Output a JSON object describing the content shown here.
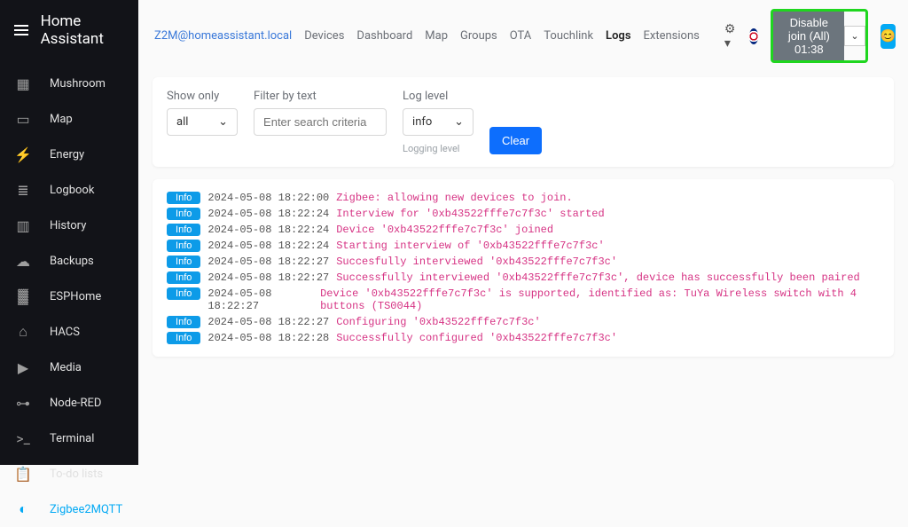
{
  "app_title": "Home Assistant",
  "sidebar": {
    "items": [
      {
        "label": "Mushroom",
        "icon": "dashboard-icon"
      },
      {
        "label": "Map",
        "icon": "map-marker-icon"
      },
      {
        "label": "Energy",
        "icon": "lightning-icon"
      },
      {
        "label": "Logbook",
        "icon": "list-icon"
      },
      {
        "label": "History",
        "icon": "chart-icon"
      },
      {
        "label": "Backups",
        "icon": "cloud-icon"
      },
      {
        "label": "ESPHome",
        "icon": "chip-icon"
      },
      {
        "label": "HACS",
        "icon": "hacs-icon"
      },
      {
        "label": "Media",
        "icon": "play-icon"
      },
      {
        "label": "Node-RED",
        "icon": "node-icon"
      },
      {
        "label": "Terminal",
        "icon": "terminal-icon"
      },
      {
        "label": "To-do lists",
        "icon": "clipboard-icon"
      },
      {
        "label": "Zigbee2MQTT",
        "icon": "zigbee-icon",
        "active": true
      }
    ]
  },
  "topbar": {
    "brand": "Z2M@homeassistant.local",
    "nav": [
      "Devices",
      "Dashboard",
      "Map",
      "Groups",
      "OTA",
      "Touchlink",
      "Logs",
      "Extensions"
    ],
    "active_nav": "Logs",
    "join_button": "Disable join (All) 01:38"
  },
  "filters": {
    "show_only_label": "Show only",
    "show_only_value": "all",
    "filter_text_label": "Filter by text",
    "filter_text_placeholder": "Enter search criteria",
    "log_level_label": "Log level",
    "log_level_value": "info",
    "log_level_hint": "Logging level",
    "clear_label": "Clear"
  },
  "logs": [
    {
      "level": "Info",
      "ts": "2024-05-08 18:22:00",
      "msg": "Zigbee: allowing new devices to join."
    },
    {
      "level": "Info",
      "ts": "2024-05-08 18:22:24",
      "msg": "Interview for '0xb43522fffe7c7f3c' started"
    },
    {
      "level": "Info",
      "ts": "2024-05-08 18:22:24",
      "msg": "Device '0xb43522fffe7c7f3c' joined"
    },
    {
      "level": "Info",
      "ts": "2024-05-08 18:22:24",
      "msg": "Starting interview of '0xb43522fffe7c7f3c'"
    },
    {
      "level": "Info",
      "ts": "2024-05-08 18:22:27",
      "msg": "Succesfully interviewed '0xb43522fffe7c7f3c'"
    },
    {
      "level": "Info",
      "ts": "2024-05-08 18:22:27",
      "msg": "Successfully interviewed '0xb43522fffe7c7f3c', device has successfully been paired"
    },
    {
      "level": "Info",
      "ts": "2024-05-08 18:22:27",
      "msg": "Device '0xb43522fffe7c7f3c' is supported, identified as: TuYa Wireless switch with 4 buttons (TS0044)"
    },
    {
      "level": "Info",
      "ts": "2024-05-08 18:22:27",
      "msg": "Configuring '0xb43522fffe7c7f3c'"
    },
    {
      "level": "Info",
      "ts": "2024-05-08 18:22:28",
      "msg": "Successfully configured '0xb43522fffe7c7f3c'"
    }
  ]
}
